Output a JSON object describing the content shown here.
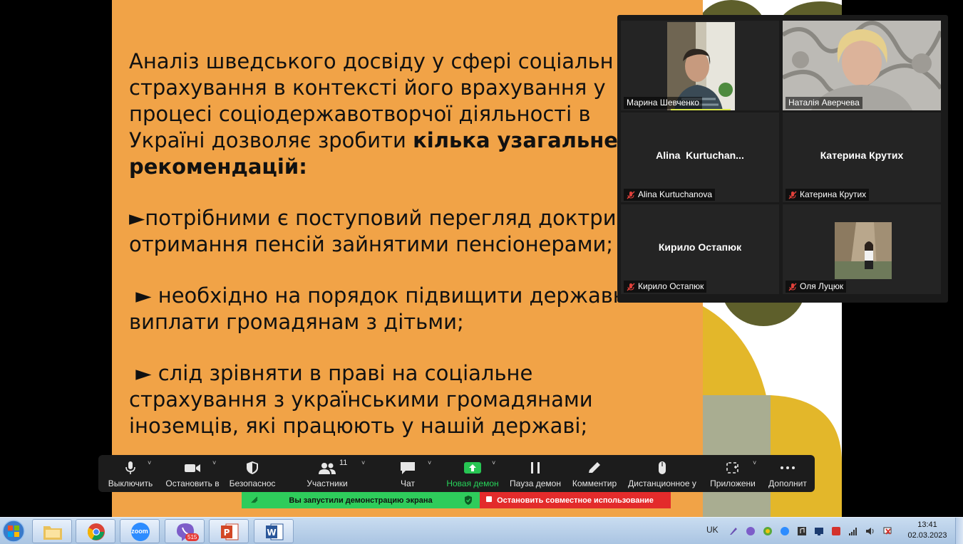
{
  "slide": {
    "paragraph1_line1": "Аналіз шведського досвіду у сфері соціальн",
    "paragraph1_line2": "страхування в контексті його врахування  у",
    "paragraph1_line3": "процесі соціодержавотворчої діяльності в",
    "paragraph1_line4_normal": "Україні дозволяє зробити ",
    "paragraph1_line4_bold": "кілька узагальне",
    "paragraph1_line5_bold": "рекомендацій:",
    "bullet1_line1": "►потрібними є поступовий перегляд доктри",
    "bullet1_line2": "отримання пенсій зайнятими пенсіонерами;",
    "bullet2_line1": " ► необхідно на порядок підвищити державн",
    "bullet2_line2": "виплати громадянам  з дітьми;",
    "bullet3_line1": " ► слід зрівняти в праві на соціальне",
    "bullet3_line2": "страхування з українськими громадянами",
    "bullet3_line3": "іноземців, які працюють у нашій державі;"
  },
  "participants": [
    {
      "label": "Марина Шевченко",
      "muted": false,
      "video": true
    },
    {
      "label": "Наталія Аверчева",
      "muted": false,
      "video": true,
      "active_speaker": true
    },
    {
      "display_name": "Alina  Kurtuchan...",
      "label": "Alina Kurtuchanova",
      "muted": true,
      "video": false
    },
    {
      "display_name": "Катерина Крутих",
      "label": "Катерина Крутих",
      "muted": true,
      "video": false
    },
    {
      "display_name": "Кирило Остапюк",
      "label": "Кирило Остапюк",
      "muted": true,
      "video": false
    },
    {
      "label": "Оля Луцюк",
      "muted": true,
      "video": true
    }
  ],
  "toolbar": {
    "mute": "Выключить",
    "video": "Остановить в",
    "security": "Безопаснос",
    "participants": "Участники",
    "participants_count": "11",
    "chat": "Чат",
    "new_share": "Новая демон",
    "pause_share": "Пауза демон",
    "annotate": "Комментир",
    "remote_control": "Дистанционное у",
    "apps": "Приложени",
    "more": "Дополнит"
  },
  "banner": {
    "sharing_text": "Вы запустили демонстрацию экрана",
    "stop_text": "Остановить совместное использование"
  },
  "taskbar": {
    "language": "UK",
    "time": "13:41",
    "date": "02.03.2023",
    "viber_badge": "515",
    "zoom_label": "zoom"
  },
  "colors": {
    "slide_orange": "#F1A347",
    "toolbar_bg": "#1c1c1c",
    "share_green": "#2ecc5b",
    "stop_red": "#e32b2b",
    "active_speaker": "#c8e34a"
  }
}
